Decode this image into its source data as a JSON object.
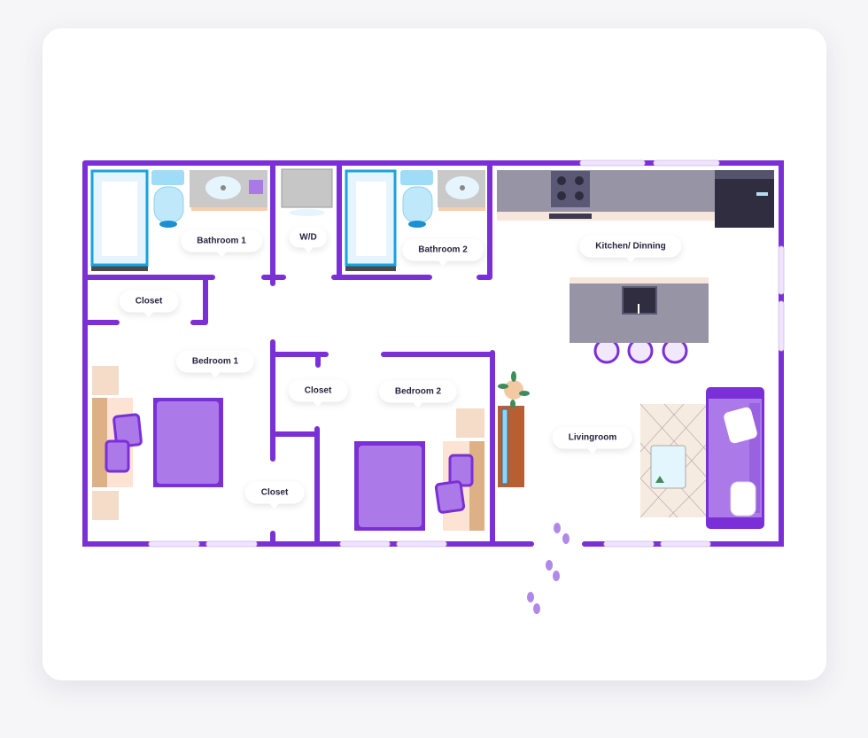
{
  "colors": {
    "wall": "#7b2fd6",
    "accent": "#a97ae6",
    "window": "#efe4fb",
    "fixture_blue": "#1aa3dc",
    "counter": "#8f8ca0"
  },
  "rooms": [
    {
      "label": "Bathroom 1"
    },
    {
      "label": "W/D"
    },
    {
      "label": "Bathroom 2"
    },
    {
      "label": "Closet"
    },
    {
      "label": "Kitchen/ Dinning"
    },
    {
      "label": "Bedroom 1"
    },
    {
      "label": "Closet"
    },
    {
      "label": "Bedroom 2"
    },
    {
      "label": "Livingroom"
    },
    {
      "label": "Closet"
    }
  ],
  "icons": [
    "bathtub-icon",
    "toilet-icon",
    "sink-icon",
    "washer-dryer-icon",
    "stove-icon",
    "refrigerator-icon",
    "kitchen-island-icon",
    "bar-stool-icon",
    "bed-icon",
    "nightstand-icon",
    "tv-stand-icon",
    "plant-icon",
    "rug-icon",
    "coffee-table-icon",
    "sofa-icon",
    "footprints-icon"
  ]
}
